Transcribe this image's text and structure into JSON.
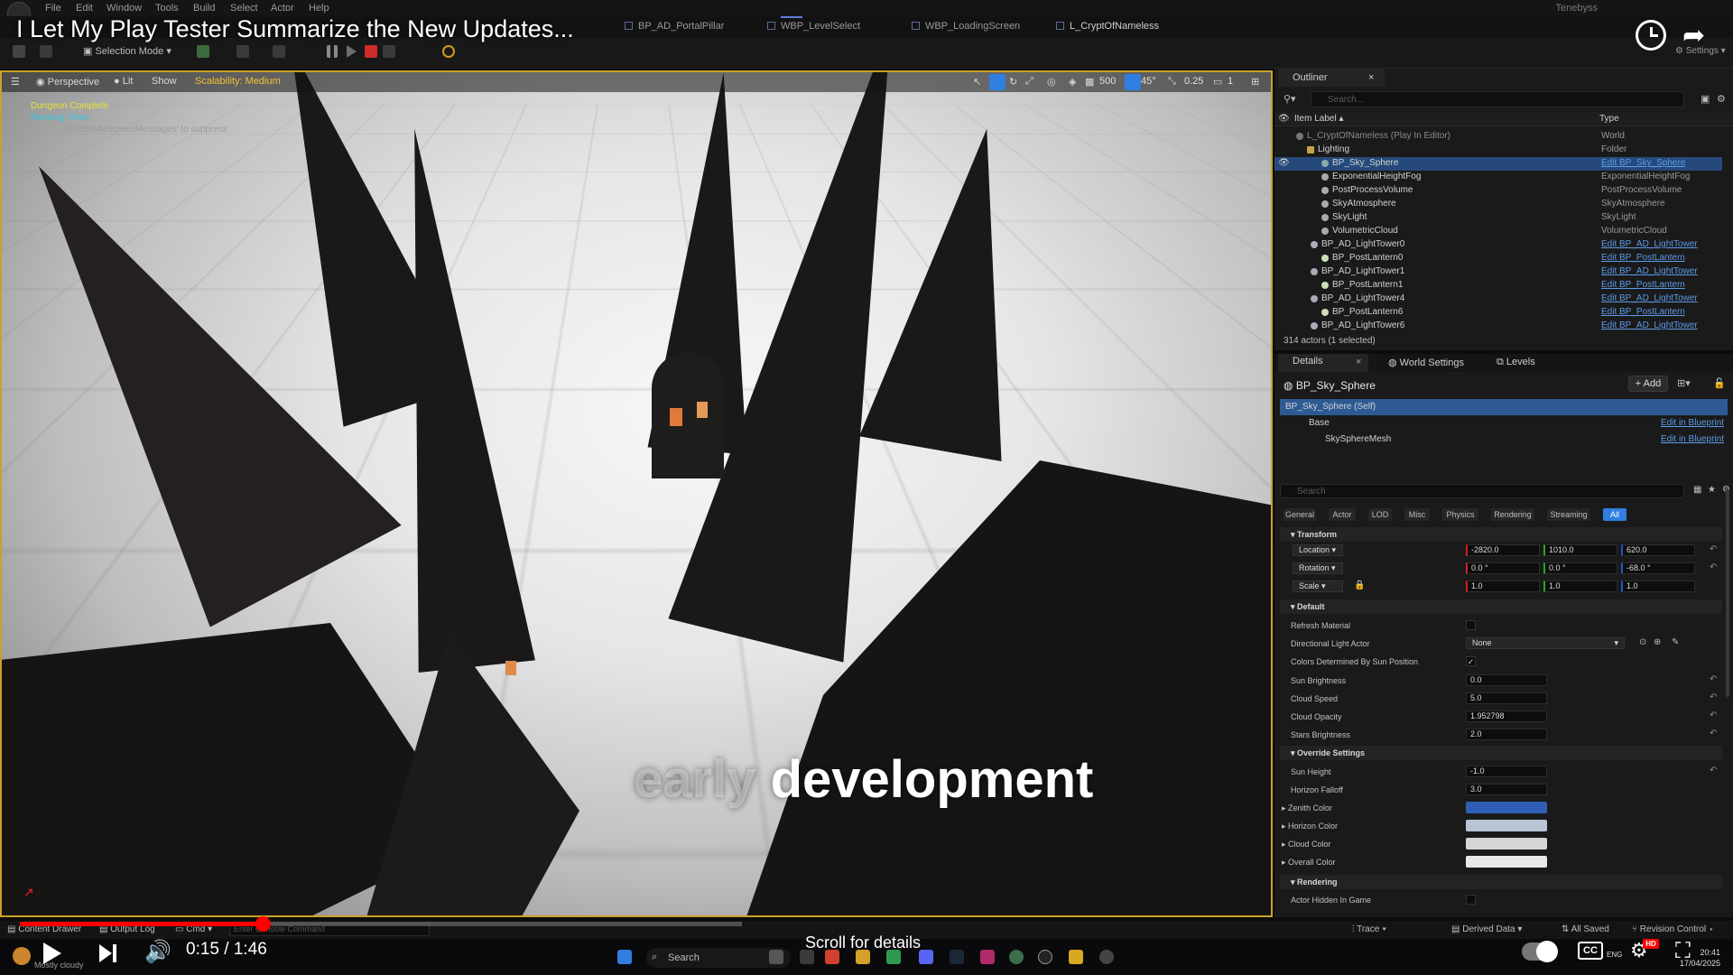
{
  "editor": {
    "menu": [
      "File",
      "Edit",
      "Window",
      "Tools",
      "Build",
      "Select",
      "Actor",
      "Help"
    ],
    "user": "Tenebyss",
    "doc_tabs": [
      "BP_AD_PortalPillar",
      "WBP_LevelSelect",
      "WBP_LoadingScreen",
      "L_CryptOfNameless"
    ],
    "selection_mode": "Selection Mode",
    "settings_label": "Settings"
  },
  "video": {
    "title": "I Let My Play Tester Summarize the New Updates...",
    "subtitle_faded": "early",
    "subtitle": "development",
    "time_current": "0:15",
    "time_separator": "/",
    "time_total": "1:46",
    "progress": 0.14,
    "scroll_hint": "Scroll for details"
  },
  "viewport": {
    "perspective": "Perspective",
    "lit": "Lit",
    "show": "Show",
    "scalability": "Scalability: Medium",
    "grid_snap": "500",
    "angle_snap": "45°",
    "scale_snap": "0.25",
    "camera_speed": "1",
    "debug_messages": [
      "Dungeon Complete",
      "Running Timer",
      "'DisableAllScreenMessages' to suppress"
    ]
  },
  "outliner": {
    "tab": "Outliner",
    "search_placeholder": "Search...",
    "col_label": "Item Label ▴",
    "col_type": "Type",
    "rows": [
      {
        "label": "L_CryptOfNameless (Play In Editor)",
        "type": "World"
      },
      {
        "label": "Lighting",
        "type": "Folder"
      },
      {
        "label": "BP_Sky_Sphere",
        "type": "Edit BP_Sky_Sphere"
      },
      {
        "label": "ExponentialHeightFog",
        "type": "ExponentialHeightFog"
      },
      {
        "label": "PostProcessVolume",
        "type": "PostProcessVolume"
      },
      {
        "label": "SkyAtmosphere",
        "type": "SkyAtmosphere"
      },
      {
        "label": "SkyLight",
        "type": "SkyLight"
      },
      {
        "label": "VolumetricCloud",
        "type": "VolumetricCloud"
      },
      {
        "label": "BP_AD_LightTower0",
        "type": "Edit BP_AD_LightTower"
      },
      {
        "label": "BP_PostLantern0",
        "type": "Edit BP_PostLantern"
      },
      {
        "label": "BP_AD_LightTower1",
        "type": "Edit BP_AD_LightTower"
      },
      {
        "label": "BP_PostLantern1",
        "type": "Edit BP_PostLantern"
      },
      {
        "label": "BP_AD_LightTower4",
        "type": "Edit BP_AD_LightTower"
      },
      {
        "label": "BP_PostLantern6",
        "type": "Edit BP_PostLantern"
      },
      {
        "label": "BP_AD_LightTower6",
        "type": "Edit BP_AD_LightTower"
      }
    ],
    "footer": "314 actors (1 selected)"
  },
  "details": {
    "tabs": [
      "Details",
      "World Settings",
      "Levels"
    ],
    "actor": "BP_Sky_Sphere",
    "add_label": "+ Add",
    "components": [
      {
        "label": "BP_Sky_Sphere (Self)",
        "link": ""
      },
      {
        "label": "Base",
        "link": "Edit in Blueprint"
      },
      {
        "label": "SkySphereMesh",
        "link": "Edit in Blueprint"
      }
    ],
    "search_placeholder": "Search",
    "categories": [
      "General",
      "Actor",
      "LOD",
      "Misc",
      "Physics",
      "Rendering",
      "Streaming",
      "All"
    ],
    "transform": {
      "section": "Transform",
      "location_label": "Location",
      "rotation_label": "Rotation",
      "scale_label": "Scale",
      "location": [
        "-2820.0",
        "1010.0",
        "620.0"
      ],
      "rotation": [
        "0.0 °",
        "0.0 °",
        "-68.0 °"
      ],
      "scale": [
        "1.0",
        "1.0",
        "1.0"
      ]
    },
    "default": {
      "section": "Default",
      "refresh_material": "Refresh Material",
      "directional_light_actor": "Directional Light Actor",
      "directional_light_value": "None",
      "colors_by_sun": "Colors Determined By Sun Position",
      "sun_brightness": "Sun Brightness",
      "sun_brightness_value": "0.0",
      "cloud_speed": "Cloud Speed",
      "cloud_speed_value": "5.0",
      "cloud_opacity": "Cloud Opacity",
      "cloud_opacity_value": "1.952798",
      "stars_brightness": "Stars Brightness",
      "stars_brightness_value": "2.0"
    },
    "override": {
      "section": "Override Settings",
      "sun_height": "Sun Height",
      "sun_height_value": "-1.0",
      "horizon_falloff": "Horizon Falloff",
      "horizon_falloff_value": "3.0",
      "zenith_color": "Zenith Color",
      "horizon_color": "Horizon Color",
      "cloud_color": "Cloud Color",
      "overall_color": "Overall Color",
      "zenith_hex": "#2f5fb5",
      "horizon_hex": "#b9c4d4",
      "cloud_hex": "#d6d6d6",
      "overall_hex": "#e8e8e8"
    },
    "rendering": {
      "section": "Rendering",
      "actor_hidden": "Actor Hidden In Game"
    }
  },
  "statusbar": {
    "content_drawer": "Content Drawer",
    "output_log": "Output Log",
    "cmd": "Cmd",
    "console_placeholder": "Enter Console Command",
    "trace": "Trace",
    "derived_data": "Derived Data",
    "all_saved": "All Saved",
    "revision_control": "Revision Control"
  },
  "taskbar": {
    "weather": "Mostly cloudy",
    "search": "Search",
    "lang": "ENG",
    "time": "20:41",
    "date": "17/04/2025"
  },
  "colors": {
    "accent": "#2f7ee0",
    "progress_red": "#ff0000",
    "viewport_border": "#c9a227",
    "link": "#5d9be8"
  }
}
